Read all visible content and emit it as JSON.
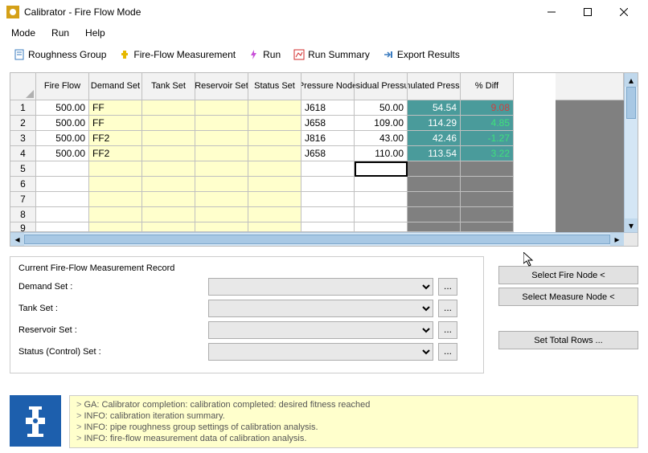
{
  "window": {
    "title": "Calibrator - Fire Flow Mode"
  },
  "menu": {
    "mode": "Mode",
    "run": "Run",
    "help": "Help"
  },
  "tabs": {
    "roughness": "Roughness Group",
    "fireflow": "Fire-Flow Measurement",
    "run": "Run",
    "runsummary": "Run Summary",
    "export": "Export Results"
  },
  "table": {
    "headers": {
      "fireflow": "Fire Flow",
      "demand": "Demand Set",
      "tank": "Tank Set",
      "reservoir": "Reservoir Set",
      "status": "Status Set",
      "pnode": "Pressure Node",
      "residual": "Residual Pressure",
      "simulated": "Simulated Pressure",
      "diff": "% Diff"
    },
    "rows": [
      {
        "n": "1",
        "ff": "500.00",
        "ds": "FF",
        "ts": "",
        "rs": "",
        "ss": "",
        "pn": "J618",
        "rp": "50.00",
        "sp": "54.54",
        "diff": "9.08",
        "dclass": "diff-pos"
      },
      {
        "n": "2",
        "ff": "500.00",
        "ds": "FF",
        "ts": "",
        "rs": "",
        "ss": "",
        "pn": "J658",
        "rp": "109.00",
        "sp": "114.29",
        "diff": "4.85",
        "dclass": "diff-neg"
      },
      {
        "n": "3",
        "ff": "500.00",
        "ds": "FF2",
        "ts": "",
        "rs": "",
        "ss": "",
        "pn": "J816",
        "rp": "43.00",
        "sp": "42.46",
        "diff": "-1.27",
        "dclass": "diff-neg"
      },
      {
        "n": "4",
        "ff": "500.00",
        "ds": "FF2",
        "ts": "",
        "rs": "",
        "ss": "",
        "pn": "J658",
        "rp": "110.00",
        "sp": "113.54",
        "diff": "3.22",
        "dclass": "diff-neg"
      }
    ]
  },
  "form": {
    "legend": "Current Fire-Flow Measurement Record",
    "demand": "Demand Set :",
    "tank": "Tank Set :",
    "reservoir": "Reservoir Set :",
    "status": "Status (Control) Set :",
    "dots": "..."
  },
  "buttons": {
    "selectfire": "Select Fire Node <",
    "selectmeasure": "Select Measure Node <",
    "totalrows": "Set Total Rows ..."
  },
  "log": {
    "l1": "GA: Calibrator completion: calibration completed: desired fitness reached",
    "l2": "INFO: calibration iteration summary.",
    "l3": "INFO: pipe roughness group settings of calibration analysis.",
    "l4": "INFO: fire-flow measurement data of calibration analysis."
  }
}
